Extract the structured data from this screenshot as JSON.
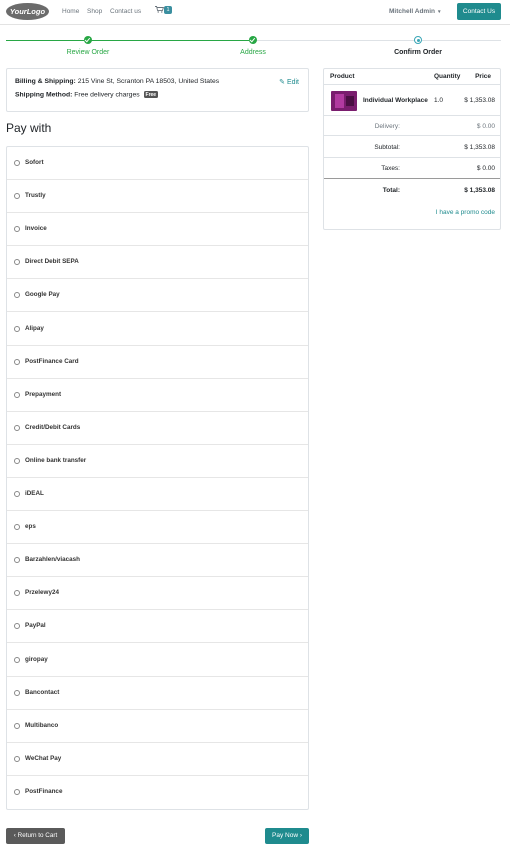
{
  "nav": {
    "logo": "YourLogo",
    "links": [
      "Home",
      "Shop",
      "Contact us"
    ],
    "cart_count": "1",
    "user": "Mitchell Admin",
    "contact_button": "Contact Us"
  },
  "wizard": {
    "steps": [
      {
        "label": "Review Order",
        "state": "done"
      },
      {
        "label": "Address",
        "state": "done"
      },
      {
        "label": "Confirm Order",
        "state": "current"
      }
    ]
  },
  "address": {
    "billing_label": "Billing & Shipping:",
    "billing_value": "215 Vine St, Scranton PA 18503, United States",
    "shipping_label": "Shipping Method:",
    "shipping_value": "Free delivery charges",
    "free_badge": "Free",
    "edit_label": "Edit"
  },
  "payment": {
    "title": "Pay with",
    "methods": [
      "Sofort",
      "Trustly",
      "Invoice",
      "Direct Debit SEPA",
      "Google Pay",
      "Alipay",
      "PostFinance Card",
      "Prepayment",
      "Credit/Debit Cards",
      "Online bank transfer",
      "iDEAL",
      "eps",
      "Barzahlen/viacash",
      "Przelewy24",
      "PayPal",
      "giropay",
      "Bancontact",
      "Multibanco",
      "WeChat Pay",
      "PostFinance"
    ]
  },
  "buttons": {
    "return": "Return to Cart",
    "pay": "Pay Now"
  },
  "summary": {
    "headers": {
      "product": "Product",
      "quantity": "Quantity",
      "price": "Price"
    },
    "item": {
      "name": "Individual Workplace",
      "quantity": "1.0",
      "price": "$ 1,353.08"
    },
    "delivery_label": "Delivery:",
    "delivery_value": "$ 0.00",
    "subtotal_label": "Subtotal:",
    "subtotal_value": "$ 1,353.08",
    "taxes_label": "Taxes:",
    "taxes_value": "$ 0.00",
    "total_label": "Total:",
    "total_value": "$ 1,353.08",
    "promo": "I have a promo code"
  },
  "colors": {
    "accent": "#1f8b8e",
    "success": "#28a745",
    "button_dark": "#5a5a5a"
  }
}
